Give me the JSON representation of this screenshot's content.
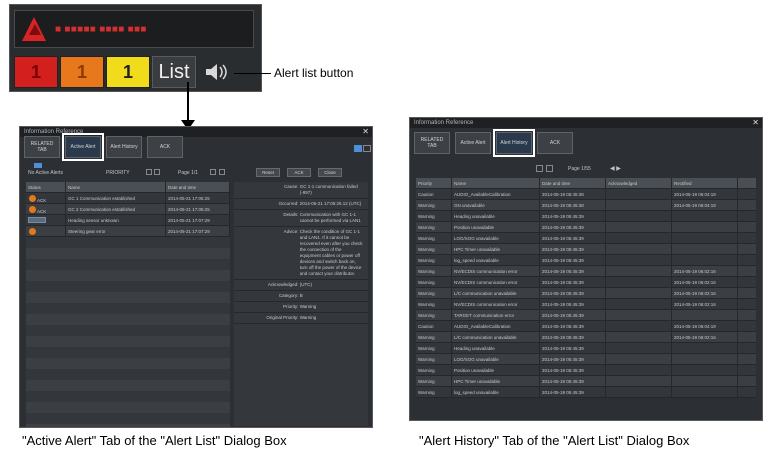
{
  "panel": {
    "alert_message": "■ ■■■■■ ■■■■ ■■■",
    "counts": [
      "1",
      "1",
      "1"
    ],
    "list_label": "List",
    "callout": "Alert list button"
  },
  "dialogs": {
    "active": {
      "title": "Information Reference",
      "tabs": [
        "RELATED TAB",
        "Active Alert",
        "Alert History",
        "ACK"
      ],
      "active_tab_index": 1,
      "toolbar": {
        "filter_label": "No Active Alerts",
        "priority_label": "PRIORITY",
        "page_label": "Page 1/1",
        "btn_reset": "Reset",
        "btn_ack": "ACK",
        "btn_close": "Close"
      },
      "columns": [
        "Status",
        "Name",
        "Date and time"
      ],
      "rows": [
        [
          "ACK",
          "GC 1 Communication established",
          "2014-05-21 17:05:25"
        ],
        [
          "ACK",
          "GC 2 Communication established",
          "2014-05-21 17:05:25"
        ],
        [
          "",
          "Heading sensor unknown",
          "2014-05-21 17:07:29"
        ],
        [
          "",
          "Steering gear error",
          "2014-05-21 17:07:29"
        ]
      ],
      "details": [
        {
          "k": "Cause:",
          "v": "GC 1-1 communication failed (-897)"
        },
        {
          "k": "Occurred:",
          "v": "2014-05-21 17:05:25.12 (UTC)"
        },
        {
          "k": "Details:",
          "v": "Communication with GC 1-1 cannot be performed via LAN1"
        },
        {
          "k": "Advice:",
          "v": "Check the condition of GC 1-1 and LAN1. If it cannot be recovered even after you check the connection of the equipment cables or power off devices and switch back on, turn off the power of the device and contact your distributor."
        },
        {
          "k": "Acknowledged:",
          "v": "(UTC)"
        },
        {
          "k": "Category:",
          "v": "B"
        },
        {
          "k": "Priority:",
          "v": "Warning"
        },
        {
          "k": "Original Priority:",
          "v": "Warning"
        }
      ]
    },
    "history": {
      "title": "Information Reference",
      "tabs": [
        "RELATED TAB",
        "Active Alert",
        "Alert History",
        "ACK"
      ],
      "active_tab_index": 2,
      "page_label": "Page 1/55",
      "columns": [
        "Priority",
        "Name",
        "Date and time",
        "Acknowledged",
        "Rectified"
      ],
      "rows": [
        [
          "Caution",
          "AUDIO_AvailableCalibration",
          "2014-05-19 05:45:38",
          "",
          "2014-05-19 06:04:19"
        ],
        [
          "Warning",
          "GN unavailable",
          "2014-05-19 05:45:38",
          "",
          "2014-05-19 06:04:19"
        ],
        [
          "Warning",
          "Heading unavailable",
          "2014-05-19 05:45:39",
          "",
          ""
        ],
        [
          "Warning",
          "Position unavailable",
          "2014-05-19 05:45:39",
          "",
          ""
        ],
        [
          "Warning",
          "LOG/SOG unavailable",
          "2014-05-19 05:45:39",
          "",
          ""
        ],
        [
          "Warning",
          "HPC Timer unavailable",
          "2014-05-19 05:45:39",
          "",
          ""
        ],
        [
          "Warning",
          "log_speed unavailable",
          "2014-05-19 05:45:39",
          "",
          ""
        ],
        [
          "Warning",
          "NV/ECDIS communication error",
          "2014-05-19 05:45:39",
          "",
          "2014-05-19 06:02:16"
        ],
        [
          "Warning",
          "NV/ECDIS communication error",
          "2014-05-19 05:45:39",
          "",
          "2014-05-19 06:02:16"
        ],
        [
          "Warning",
          "L/C communication unavailable",
          "2014-05-19 05:45:39",
          "",
          "2014-05-19 06:02:16"
        ],
        [
          "Warning",
          "NV/ECDIS communication error",
          "2014-05-19 05:45:39",
          "",
          "2014-05-19 06:02:16"
        ],
        [
          "Warning",
          "TARGET communication error",
          "2014-05-19 05:45:39",
          "",
          ""
        ],
        [
          "Caution",
          "AUDIO_AvailableCalibration",
          "2014-05-19 05:45:39",
          "",
          "2014-05-19 06:04:19"
        ],
        [
          "Warning",
          "L/C communication unavailable",
          "2014-05-19 05:45:39",
          "",
          "2014-05-19 06:02:16"
        ],
        [
          "Warning",
          "Heading unavailable",
          "2014-05-19 05:45:39",
          "",
          ""
        ],
        [
          "Warning",
          "LOG/SOG unavailable",
          "2014-05-19 05:45:39",
          "",
          ""
        ],
        [
          "Warning",
          "Position unavailable",
          "2014-05-19 05:45:39",
          "",
          ""
        ],
        [
          "Warning",
          "HPC Timer unavailable",
          "2014-05-19 05:45:39",
          "",
          ""
        ],
        [
          "Warning",
          "log_speed unavailable",
          "2014-05-19 05:45:39",
          "",
          ""
        ]
      ]
    }
  },
  "captions": {
    "active": "\"Active Alert\" Tab of the \"Alert List\" Dialog Box",
    "history": "\"Alert History\" Tab of the \"Alert List\" Dialog Box"
  }
}
